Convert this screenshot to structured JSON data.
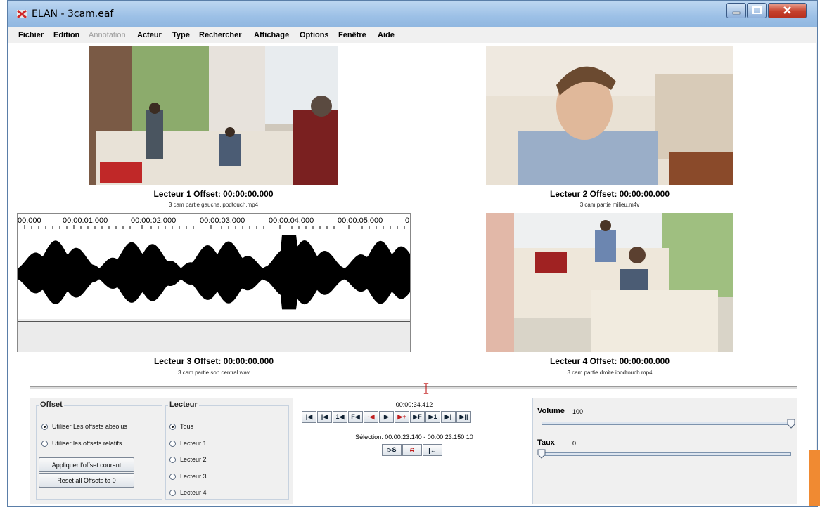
{
  "window": {
    "title": "ELAN - 3cam.eaf"
  },
  "menu": [
    "Fichier",
    "Edition",
    "Annotation",
    "Acteur",
    "Type",
    "Rechercher",
    "Affichage",
    "Options",
    "Fenêtre",
    "Aide"
  ],
  "players": [
    {
      "title": "Lecteur 1 Offset: 00:00:00.000",
      "file": "3 cam partie gauche.ipodtouch.mp4"
    },
    {
      "title": "Lecteur 2 Offset: 00:00:00.000",
      "file": "3 cam partie milieu.m4v"
    },
    {
      "title": "Lecteur 3 Offset: 00:00:00.000",
      "file": "3 cam partie son central.wav"
    },
    {
      "title": "Lecteur 4 Offset: 00:00:00.000",
      "file": "3 cam partie droite.ipodtouch.mp4"
    }
  ],
  "waveform": {
    "ticks": [
      "00.000",
      "00:00:01.000",
      "00:00:02.000",
      "00:00:03.000",
      "00:00:04.000",
      "00:00:05.000",
      "0"
    ]
  },
  "offset": {
    "title": "Offset",
    "options": [
      "Utiliser Les offsets absolus",
      "Utiliser les offsets relatifs"
    ],
    "selected": "Utiliser Les offsets absolus",
    "apply_label": "Appliquer l'offset courant",
    "reset_label": "Reset all Offsets to 0"
  },
  "lecteur": {
    "title": "Lecteur",
    "options": [
      "Tous",
      "Lecteur 1",
      "Lecteur 2",
      "Lecteur 3",
      "Lecteur 4"
    ],
    "selected": "Tous"
  },
  "controls": {
    "time": "00:00:34.412",
    "selection": "Sélection: 00:00:23.140 - 00:00:23.150  10",
    "buttons": [
      "|◀",
      "|◀",
      "1◀",
      "F◀",
      "-◀",
      "▶",
      "▶+",
      "▶F",
      "▶1",
      "▶|",
      "▶||"
    ],
    "sel_buttons": [
      "▷S",
      "S",
      "|←"
    ]
  },
  "volume": {
    "label": "Volume",
    "value": "100",
    "level": 1.0
  },
  "rate": {
    "label": "Taux",
    "value": "0",
    "level": 0.0
  }
}
